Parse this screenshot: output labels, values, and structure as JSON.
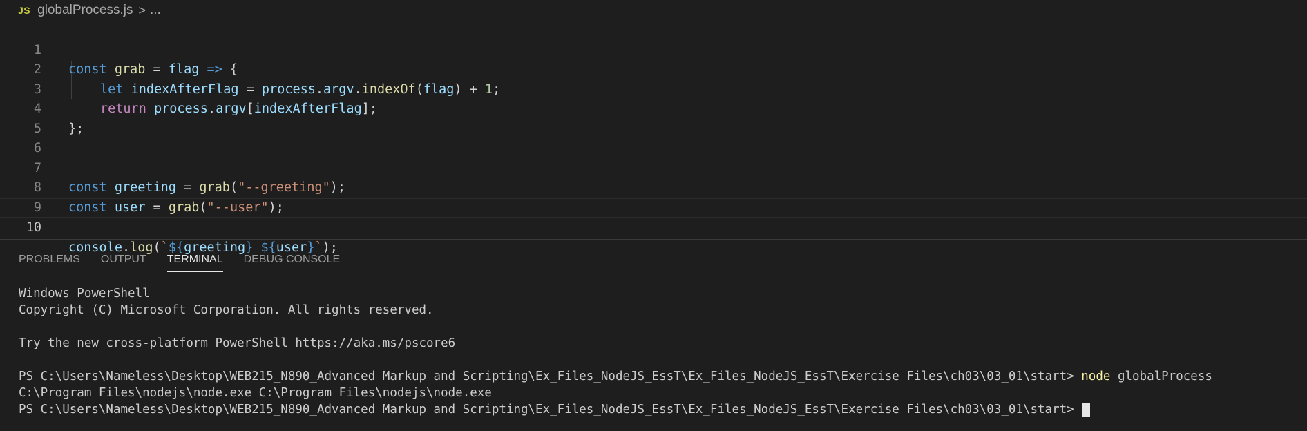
{
  "breadcrumb": {
    "file_icon": "JS",
    "file_name": "globalProcess.js",
    "separator": ">",
    "ellipsis": "..."
  },
  "editor": {
    "line_numbers": [
      "1",
      "2",
      "3",
      "4",
      "5",
      "6",
      "7",
      "8",
      "9",
      "10"
    ],
    "active_line": "10",
    "lines": {
      "l1": [
        "const",
        " ",
        "grab",
        " = ",
        "flag",
        " ",
        "=>",
        " {"
      ],
      "l2": [
        "let",
        " ",
        "indexAfterFlag",
        " = ",
        "process",
        ".",
        "argv",
        ".",
        "indexOf",
        "(",
        "flag",
        ") + ",
        "1",
        ";"
      ],
      "l3": [
        "return",
        " ",
        "process",
        ".",
        "argv",
        "[",
        "indexAfterFlag",
        "];"
      ],
      "l4": [
        "};"
      ],
      "l7": [
        "const",
        " ",
        "greeting",
        " = ",
        "grab",
        "(",
        "\"--greeting\"",
        ");"
      ],
      "l8": [
        "const",
        " ",
        "user",
        " = ",
        "grab",
        "(",
        "\"--user\"",
        ");"
      ],
      "l10": [
        "console",
        ".",
        "log",
        "(",
        "`",
        "${",
        "greeting",
        "}",
        " ",
        "${",
        "user",
        "}",
        "`",
        ");"
      ]
    }
  },
  "panel": {
    "tabs": [
      "PROBLEMS",
      "OUTPUT",
      "TERMINAL",
      "DEBUG CONSOLE"
    ],
    "active_tab": "TERMINAL"
  },
  "terminal": {
    "line1": "Windows PowerShell",
    "line2": "Copyright (C) Microsoft Corporation. All rights reserved.",
    "line3": "Try the new cross-platform PowerShell https://aka.ms/pscore6",
    "prompt1": "PS C:\\Users\\Nameless\\Desktop\\WEB215_N890_Advanced Markup and Scripting\\Ex_Files_NodeJS_EssT\\Ex_Files_NodeJS_EssT\\Exercise Files\\ch03\\03_01\\start> ",
    "cmd_node": "node",
    "cmd_arg": " globalProcess",
    "output1": "C:\\Program Files\\nodejs\\node.exe C:\\Program Files\\nodejs\\node.exe",
    "prompt2": "PS C:\\Users\\Nameless\\Desktop\\WEB215_N890_Advanced Markup and Scripting\\Ex_Files_NodeJS_EssT\\Ex_Files_NodeJS_EssT\\Exercise Files\\ch03\\03_01\\start> "
  },
  "colors": {
    "background": "#1e1e1e",
    "keyword": "#569cd6",
    "control": "#c586c0",
    "variable": "#9cdcfe",
    "function": "#dcdcaa",
    "string": "#ce9178",
    "number": "#b5cea8",
    "terminal_command": "#f9f1a5"
  }
}
